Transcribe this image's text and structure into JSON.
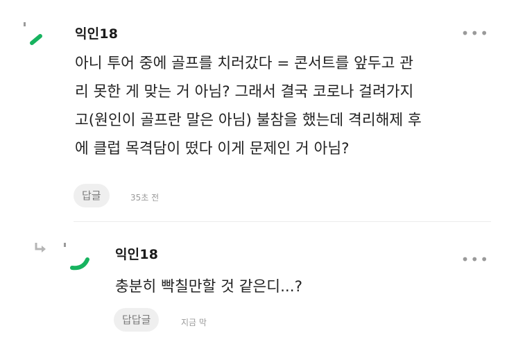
{
  "comments": [
    {
      "author": "익인18",
      "body_lines": [
        "아니 투어 중에 골프를 치러갔다 = 콘서트를 앞두고 관",
        "리 못한 게 맞는 거 아님? 그래서 결국 코로나 걸려가지",
        "고(원인이 골프란 말은 아님) 불참을 했는데 격리해제 후",
        "에 클럽 목격담이 떴다 이게 문제인 거 아님?"
      ],
      "reply_label": "답글",
      "time": "35초 전",
      "more_label": "•••"
    },
    {
      "author": "익인18",
      "body_lines": [
        "충분히 빡칠만할 것 같은디...?"
      ],
      "reply_label": "답답글",
      "time": "지금 막",
      "more_label": "•••"
    }
  ],
  "colors": {
    "avatar_green": "#17b35f",
    "avatar_dot": "#9a9a9a",
    "button_bg": "#efefef",
    "muted_text": "#9a9a9a"
  }
}
